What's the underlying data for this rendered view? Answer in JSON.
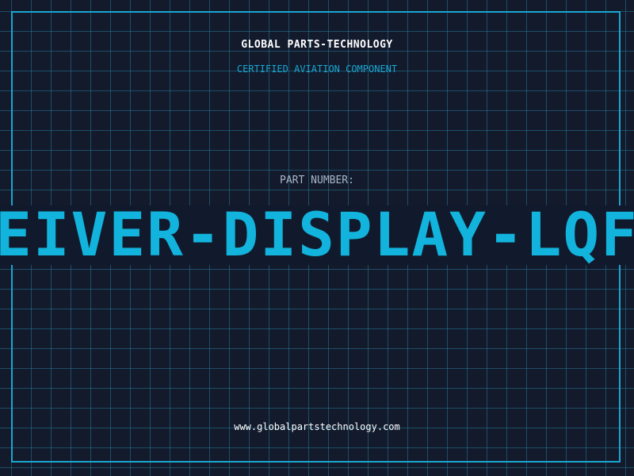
{
  "header": {
    "company_name": "GLOBAL PARTS-TECHNOLOGY",
    "tagline": "CERTIFIED AVIATION COMPONENT"
  },
  "part": {
    "label": "PART NUMBER:",
    "number": "CEIVER-DISPLAY-LQFP"
  },
  "footer": {
    "website": "www.globalpartstechnology.com"
  },
  "colors": {
    "background": "#121a2c",
    "accent": "#1aa6d0",
    "part_number": "#12b3dc",
    "label": "#a9b8c8",
    "text": "#ffffff"
  }
}
